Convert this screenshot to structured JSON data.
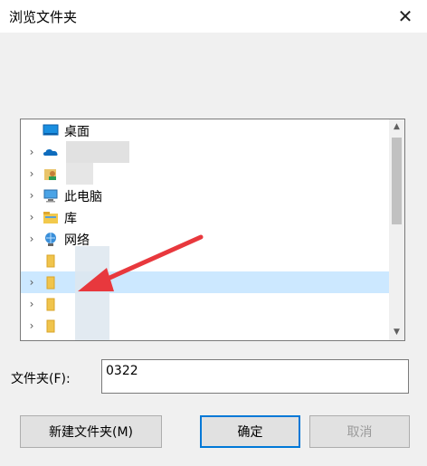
{
  "window": {
    "title": "浏览文件夹",
    "close_glyph": "✕"
  },
  "tree": {
    "items": [
      {
        "label": "桌面",
        "icon": "desktop-icon",
        "chevron": false
      },
      {
        "label": "",
        "icon": "onedrive-cloud-icon",
        "chevron": true
      },
      {
        "label": "",
        "icon": "user-folder-icon",
        "chevron": true
      },
      {
        "label": "此电脑",
        "icon": "computer-icon",
        "chevron": true
      },
      {
        "label": "库",
        "icon": "library-icon",
        "chevron": true
      },
      {
        "label": "网络",
        "icon": "network-icon",
        "chevron": true
      },
      {
        "label": "",
        "icon": "folder-icon",
        "chevron": false
      },
      {
        "label": "",
        "icon": "folder-icon",
        "chevron": true,
        "selected": true
      },
      {
        "label": "",
        "icon": "folder-icon",
        "chevron": true
      },
      {
        "label": "",
        "icon": "folder-icon",
        "chevron": true
      }
    ]
  },
  "folder_field": {
    "label": "文件夹(F):",
    "value": "0322"
  },
  "buttons": {
    "new_folder": "新建文件夹(M)",
    "ok": "确定",
    "cancel": "取消"
  },
  "colors": {
    "accent": "#0078d7",
    "arrow": "#e8383d",
    "selection": "#cce8ff"
  }
}
